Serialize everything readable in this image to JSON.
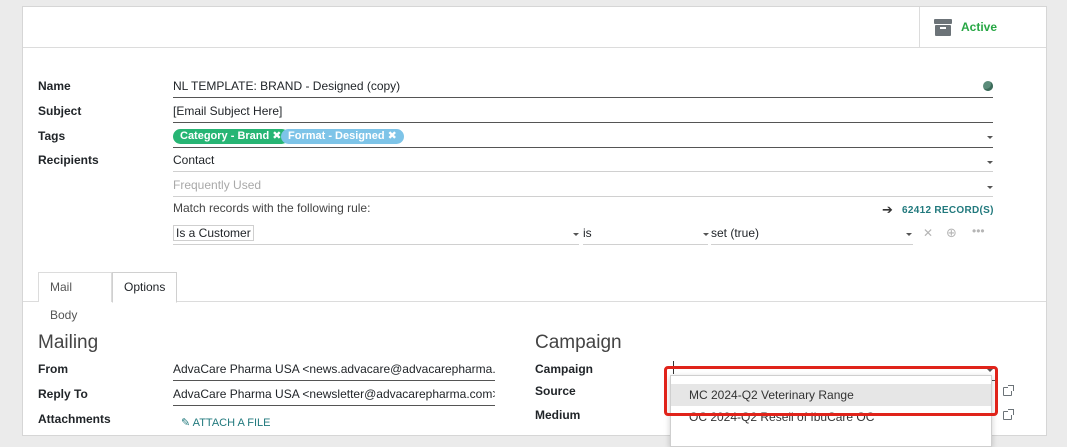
{
  "status": {
    "active_label": "Active"
  },
  "form": {
    "name": {
      "label": "Name",
      "value": "NL TEMPLATE: BRAND - Designed (copy)"
    },
    "subject": {
      "label": "Subject",
      "value": "[Email Subject Here]"
    },
    "tags": {
      "label": "Tags",
      "items": [
        {
          "label": "Category - Brand",
          "color": "#27b574"
        },
        {
          "label": "Format - Designed",
          "color": "#7ec4e8"
        }
      ]
    },
    "recipients": {
      "label": "Recipients",
      "value": "Contact",
      "placeholder": "Frequently Used"
    },
    "rule": {
      "label": "Match records with the following rule:",
      "records": "62412 RECORD(S)",
      "field": "Is a Customer",
      "operator": "is",
      "value": "set (true)"
    }
  },
  "tabs": [
    {
      "label": "Mail Body",
      "active": false
    },
    {
      "label": "Options",
      "active": true
    }
  ],
  "mailing": {
    "title": "Mailing",
    "from_label": "From",
    "from_value": "AdvaCare Pharma USA <news.advacare@advacarepharma.co",
    "reply_label": "Reply To",
    "reply_value": "AdvaCare Pharma USA <newsletter@advacarepharma.com>",
    "attachments_label": "Attachments",
    "attach_button": "ATTACH A FILE"
  },
  "campaign": {
    "title": "Campaign",
    "campaign_label": "Campaign",
    "source_label": "Source",
    "medium_label": "Medium",
    "options": [
      "MC 2024-Q2 Veterinary Range",
      "OC 2024-Q2 Resell of IbuCare OC"
    ]
  },
  "colors": {
    "accent": "#21797d",
    "active_green": "#28a745",
    "highlight_border": "#e0231a"
  }
}
